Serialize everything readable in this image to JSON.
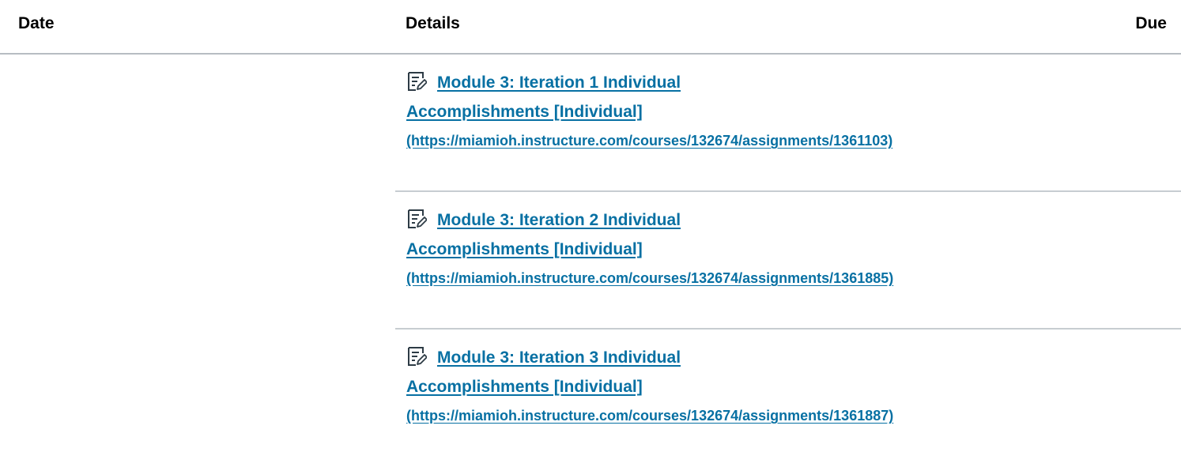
{
  "table": {
    "headers": {
      "date": "Date",
      "details": "Details",
      "due": "Due"
    },
    "rows": [
      {
        "icon": "assignment-icon",
        "title_line1": "Module 3: Iteration 1 Individual",
        "title_line2": "Accomplishments [Individual]",
        "url": "(https://miamioh.instructure.com/courses/132674/assignments/1361103)"
      },
      {
        "icon": "assignment-icon",
        "title_line1": "Module 3: Iteration 2 Individual",
        "title_line2": "Accomplishments [Individual]",
        "url": "(https://miamioh.instructure.com/courses/132674/assignments/1361885)"
      },
      {
        "icon": "assignment-icon",
        "title_line1": "Module 3: Iteration 3 Individual",
        "title_line2": "Accomplishments [Individual]",
        "url": "(https://miamioh.instructure.com/courses/132674/assignments/1361887)"
      }
    ]
  },
  "colors": {
    "link": "#0770a3",
    "divider": "#c7cdd1"
  }
}
